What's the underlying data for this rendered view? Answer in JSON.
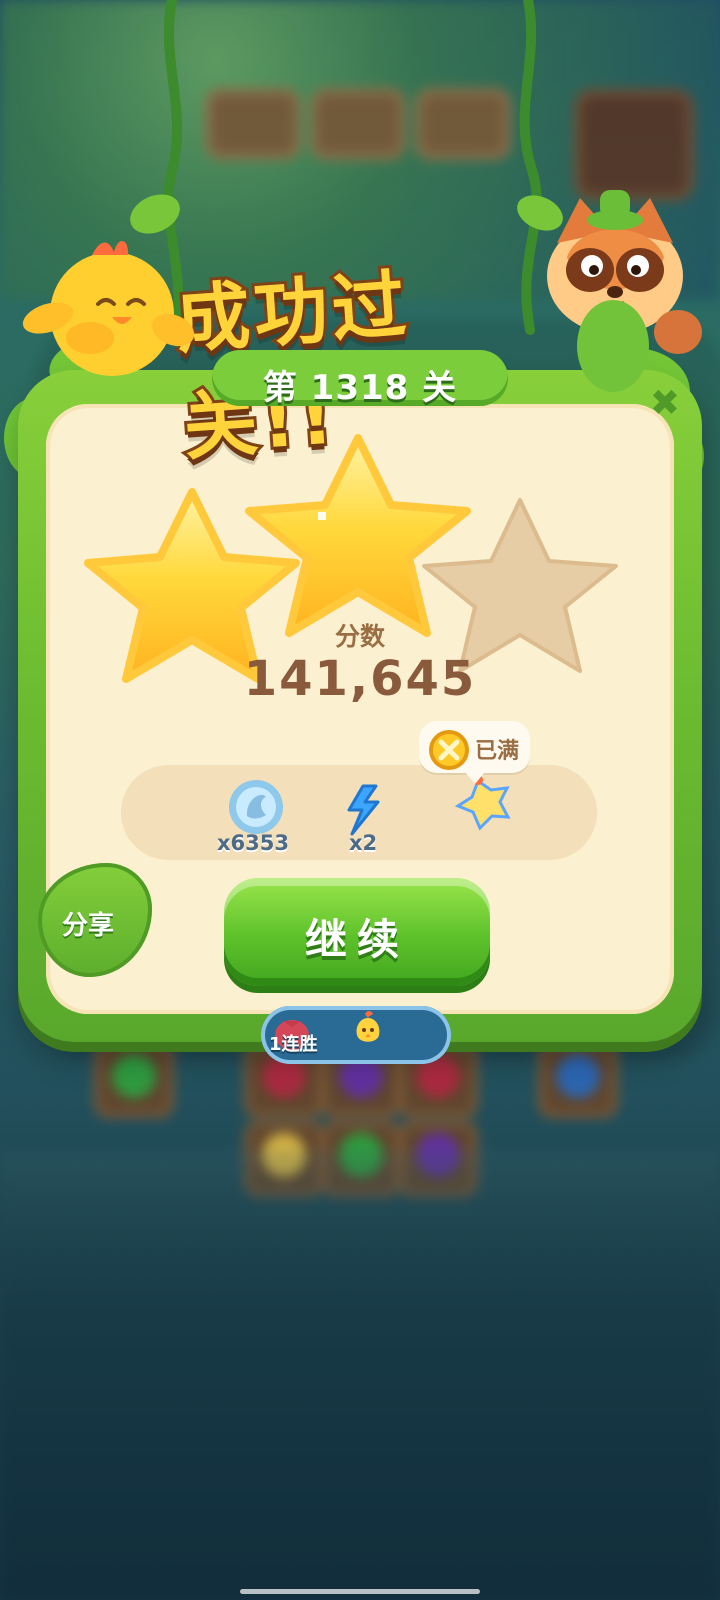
{
  "result_title": "成功过关!!",
  "level": "第 1318 关",
  "score": {
    "label": "分数",
    "value": "141,645"
  },
  "rewards": {
    "coins": "x6353",
    "lightning": "x2",
    "tooltip": "已满"
  },
  "buttons": {
    "continue": "继续",
    "share": "分享",
    "close": "✖"
  },
  "streak": {
    "label": "1连胜"
  },
  "stars": {
    "earned": 2,
    "total": 3
  }
}
